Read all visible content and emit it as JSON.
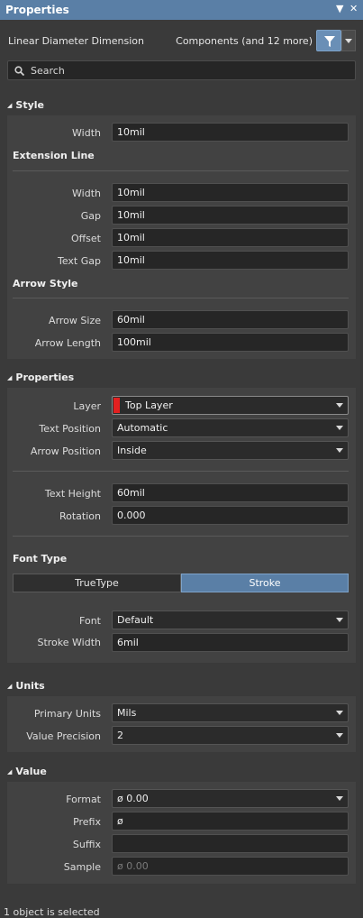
{
  "window": {
    "title": "Properties"
  },
  "header": {
    "object_type": "Linear Diameter Dimension",
    "filter_text": "Components (and 12 more)"
  },
  "search": {
    "placeholder": "Search"
  },
  "style": {
    "title": "Style",
    "width": {
      "label": "Width",
      "value": "10mil"
    },
    "extension_line": {
      "title": "Extension Line",
      "width": {
        "label": "Width",
        "value": "10mil"
      },
      "gap": {
        "label": "Gap",
        "value": "10mil"
      },
      "offset": {
        "label": "Offset",
        "value": "10mil"
      },
      "text_gap": {
        "label": "Text Gap",
        "value": "10mil"
      }
    },
    "arrow_style": {
      "title": "Arrow Style",
      "arrow_size": {
        "label": "Arrow Size",
        "value": "60mil"
      },
      "arrow_length": {
        "label": "Arrow Length",
        "value": "100mil"
      }
    }
  },
  "properties": {
    "title": "Properties",
    "layer": {
      "label": "Layer",
      "value": "Top Layer",
      "color": "#e32020"
    },
    "text_position": {
      "label": "Text Position",
      "value": "Automatic"
    },
    "arrow_position": {
      "label": "Arrow Position",
      "value": "Inside"
    },
    "text_height": {
      "label": "Text Height",
      "value": "60mil"
    },
    "rotation": {
      "label": "Rotation",
      "value": "0.000"
    },
    "font_type": {
      "title": "Font Type",
      "options": [
        "TrueType",
        "Stroke"
      ],
      "selected": "Stroke"
    },
    "font": {
      "label": "Font",
      "value": "Default"
    },
    "stroke_width": {
      "label": "Stroke Width",
      "value": "6mil"
    }
  },
  "units": {
    "title": "Units",
    "primary_units": {
      "label": "Primary Units",
      "value": "Mils"
    },
    "value_precision": {
      "label": "Value Precision",
      "value": "2"
    }
  },
  "value": {
    "title": "Value",
    "format": {
      "label": "Format",
      "value": "ø 0.00"
    },
    "prefix": {
      "label": "Prefix",
      "value": "ø"
    },
    "suffix": {
      "label": "Suffix",
      "value": ""
    },
    "sample": {
      "label": "Sample",
      "value": "ø 0.00"
    }
  },
  "status": {
    "text": "1 object is selected"
  }
}
